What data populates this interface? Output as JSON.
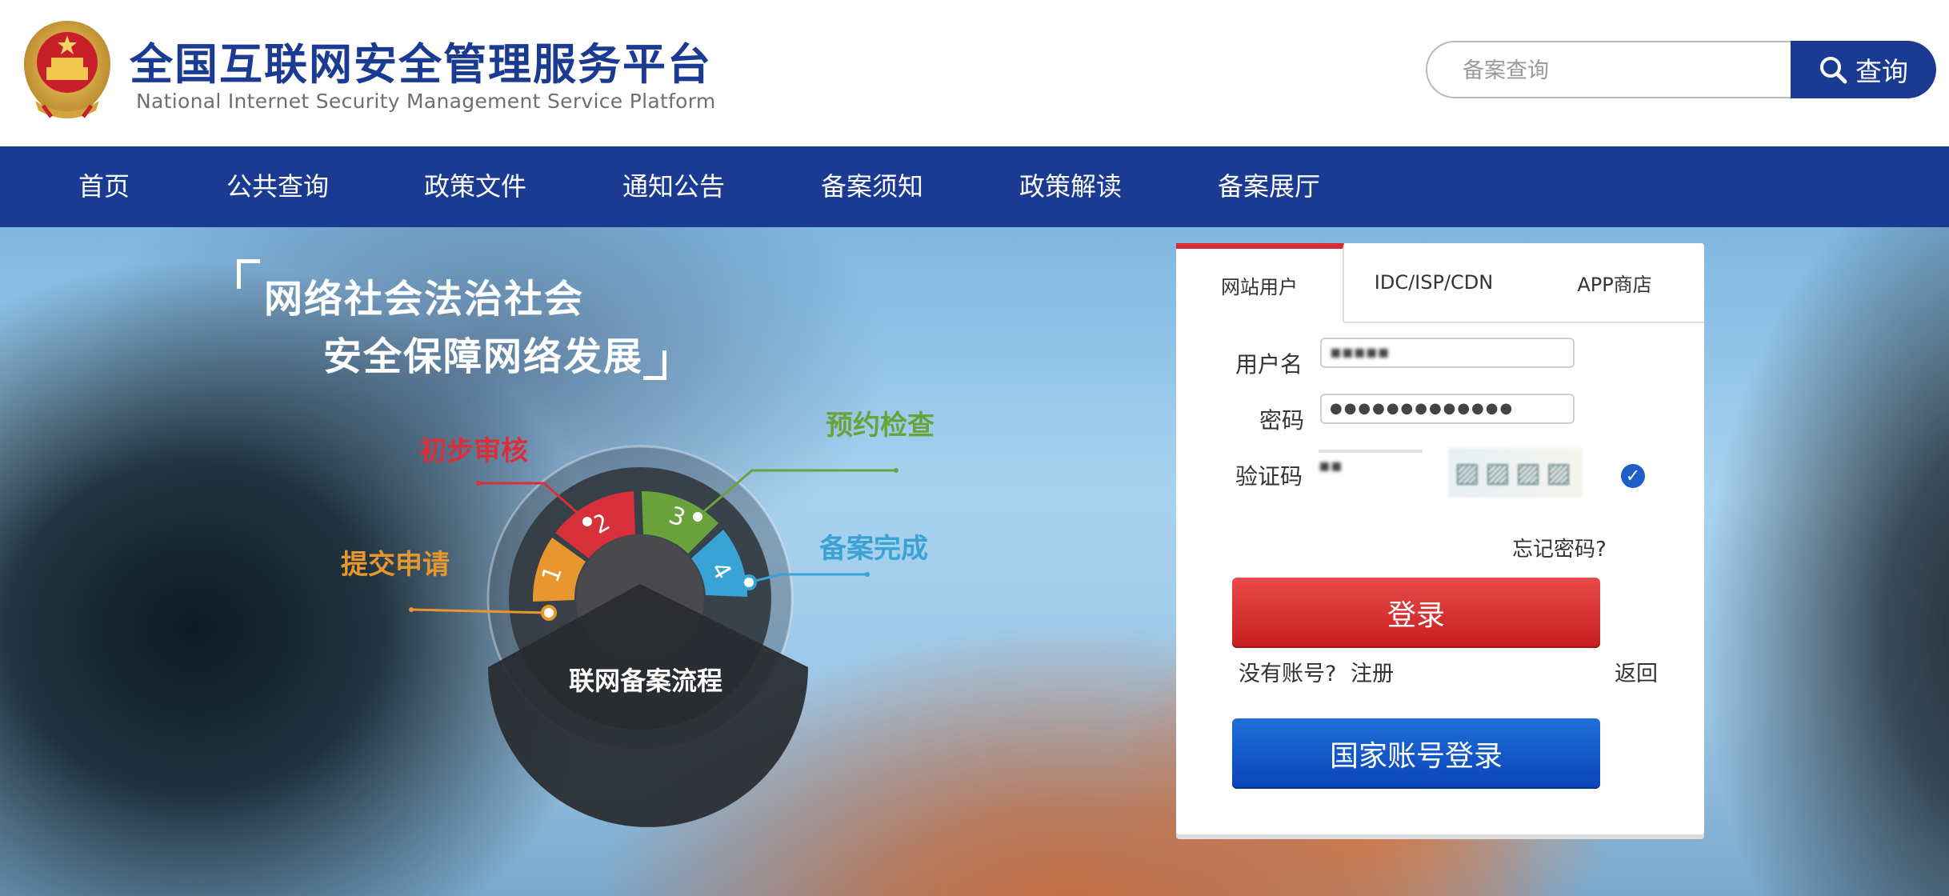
{
  "header": {
    "title": "全国互联网安全管理服务平台",
    "subtitle": "National Internet Security Management Service Platform",
    "search": {
      "placeholder": "备案查询",
      "button_label": "查询"
    }
  },
  "nav": {
    "items": [
      {
        "label": "首页"
      },
      {
        "label": "公共查询"
      },
      {
        "label": "政策文件"
      },
      {
        "label": "通知公告"
      },
      {
        "label": "备案须知"
      },
      {
        "label": "政策解读"
      },
      {
        "label": "备案展厅"
      }
    ]
  },
  "hero": {
    "slogan_line1": "网络社会法治社会",
    "slogan_line2": "安全保障网络发展",
    "process_title": "联网备案流程",
    "steps": [
      {
        "num": "1",
        "label": "提交申请",
        "color": "#e8962f"
      },
      {
        "num": "2",
        "label": "初步审核",
        "color": "#d8303a"
      },
      {
        "num": "3",
        "label": "预约检查",
        "color": "#6aa33c"
      },
      {
        "num": "4",
        "label": "备案完成",
        "color": "#3aa3d6"
      }
    ]
  },
  "login": {
    "tabs": [
      {
        "label": "网站用户",
        "active": true
      },
      {
        "label": "IDC/ISP/CDN",
        "active": false
      },
      {
        "label": "APP商店",
        "active": false
      }
    ],
    "username_label": "用户名",
    "password_label": "密码",
    "captcha_label": "验证码",
    "forgot_password": "忘记密码?",
    "login_button": "登录",
    "no_account": "没有账号?",
    "register_link": "注册",
    "back_link": "返回",
    "national_login_button": "国家账号登录",
    "accent_color": "#d32b33"
  },
  "colors": {
    "brand_blue": "#1b3a92",
    "login_red": "#d32b33",
    "national_blue": "#0a44b8"
  }
}
